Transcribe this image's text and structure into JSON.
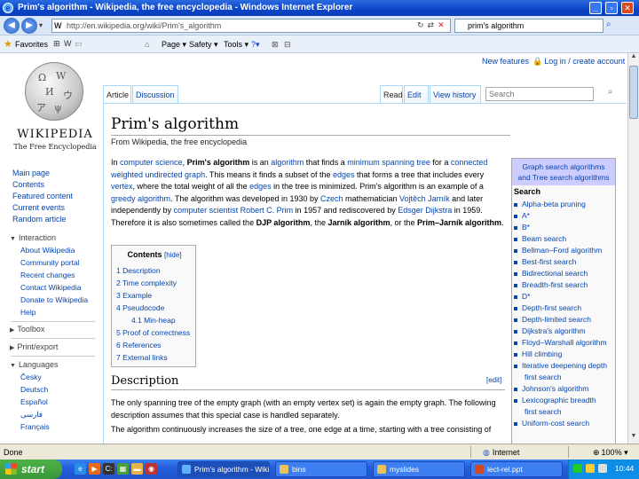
{
  "window": {
    "title": "Prim's algorithm - Wikipedia, the free encyclopedia - Windows Internet Explorer"
  },
  "addressbar": {
    "url": "http://en.wikipedia.org/wiki/Prim's_algorithm",
    "search_value": "prim's algorithm"
  },
  "commandbar": {
    "favorites": "Favorites",
    "page": "Page ▾",
    "safety": "Safety ▾",
    "tools": "Tools ▾",
    "help": "?▾"
  },
  "personal": {
    "new_features": "New features",
    "login": "Log in / create account"
  },
  "logo": {
    "wordmark": "WIKIPEDIA",
    "tagline": "The Free Encyclopedia"
  },
  "tabs": {
    "article": "Article",
    "discussion": "Discussion",
    "read": "Read",
    "edit": "Edit",
    "history": "View history",
    "search_placeholder": "Search"
  },
  "sidebar": {
    "main_links": [
      "Main page",
      "Contents",
      "Featured content",
      "Current events",
      "Random article"
    ],
    "interaction_head": "Interaction",
    "interaction_links": [
      "About Wikipedia",
      "Community portal",
      "Recent changes",
      "Contact Wikipedia",
      "Donate to Wikipedia",
      "Help"
    ],
    "toolbox_head": "Toolbox",
    "print_head": "Print/export",
    "languages_head": "Languages",
    "language_links": [
      "Česky",
      "Deutsch",
      "Español",
      "فارسی",
      "Français"
    ]
  },
  "article": {
    "title": "Prim's algorithm",
    "site_sub": "From Wikipedia, the free encyclopedia",
    "intro_p1_a": "In ",
    "intro_link_cs": "computer science",
    "intro_p1_b": ", ",
    "intro_bold_1": "Prim's algorithm",
    "intro_p1_c": " is an ",
    "intro_link_alg": "algorithm",
    "intro_p1_d": " that finds a ",
    "intro_link_mst": "minimum spanning tree",
    "intro_p1_e": " for a ",
    "intro_link_cwug": "connected weighted undirected graph",
    "intro_p1_f": ". This means it finds a subset of the ",
    "intro_link_edges": "edges",
    "intro_p1_g": " that forms a tree that includes every ",
    "intro_link_vertex": "vertex",
    "intro_p1_h": ", where the total weight of all the ",
    "intro_link_edges2": "edges",
    "intro_p1_i": " in the tree is minimized. Prim's algorithm is an example of a ",
    "intro_link_greedy": "greedy algorithm",
    "intro_p1_j": ". The algorithm was developed in 1930 by ",
    "intro_link_czech": "Czech",
    "intro_p1_k": " mathematician ",
    "intro_link_jarnik": "Vojtěch Jarník",
    "intro_p1_l": " and later independently by ",
    "intro_link_cs2": "computer scientist",
    "intro_p1_m": " ",
    "intro_link_prim": "Robert C. Prim",
    "intro_p1_n": " in 1957 and rediscovered by ",
    "intro_link_dijkstra": "Edsger Dijkstra",
    "intro_p1_o": " in 1959. Therefore it is also sometimes called the ",
    "intro_bold_2": "DJP algorithm",
    "intro_p1_p": ", the ",
    "intro_bold_3": "Jarník algorithm",
    "intro_p1_q": ", or the ",
    "intro_bold_4": "Prim–Jarník algorithm",
    "intro_p1_r": ".",
    "toc_title": "Contents",
    "toc_hide": "[hide]",
    "toc_items": [
      "1 Description",
      "2 Time complexity",
      "3 Example",
      "4 Pseudocode",
      "4.1 Min-heap",
      "5 Proof of correctness",
      "6 References",
      "7 External links"
    ],
    "section_title": "Description",
    "section_edit": "[edit]",
    "desc_p1": "The only spanning tree of the empty graph (with an empty vertex set) is again the empty graph. The following description assumes that this special case is handled separately.",
    "desc_p2": "The algorithm continuously increases the size of a tree, one edge at a time, starting with a tree consisting of"
  },
  "navbox": {
    "title_1": "Graph search algorithms",
    "title_2": "and Tree search algorithms",
    "subhead": "Search",
    "items": [
      "Alpha-beta pruning",
      "A*",
      "B*",
      "Beam search",
      "Bellman–Ford algorithm",
      "Best-first search",
      "Bidirectional search",
      "Breadth-first search",
      "D*",
      "Depth-first search",
      "Depth-limited search",
      "Dijkstra's algorithm",
      "Floyd–Warshall algorithm",
      "Hill climbing",
      "Iterative deepening depth",
      "Johnson's algorithm",
      "Lexicographic breadth",
      "Uniform-cost search"
    ],
    "continuations": [
      "first search",
      "first search"
    ]
  },
  "statusbar": {
    "done": "Done",
    "zone": "Internet",
    "zoom": "100%"
  },
  "taskbar": {
    "start": "start",
    "buttons": [
      "Prim's algorithm - Wiki...",
      "bins",
      "myslides",
      "lect-rel.ppt"
    ],
    "clock": "10:44"
  },
  "colors": {
    "link": "#0645ad",
    "navbox_title_bg": "#ccccff",
    "ie_titlebar": "#0a44c8",
    "taskbar": "#245edb",
    "start_button": "#38973a"
  }
}
